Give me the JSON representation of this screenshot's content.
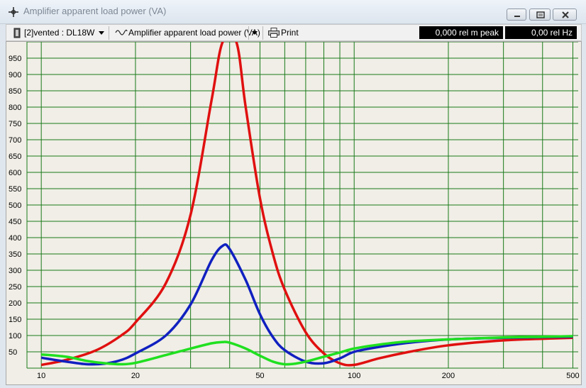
{
  "window": {
    "title": "Amplifier apparent load power (VA)",
    "minimize_label": "minimize",
    "maximize_label": "maximize",
    "close_label": "close"
  },
  "toolbar": {
    "project_select": "[2]vented : DL18W",
    "graph_select": "Amplifier apparent load power (VA)",
    "print_label": "Print",
    "readout_peak": "0,000 rel m peak",
    "readout_hz": "0,00 rel Hz"
  },
  "colors": {
    "grid": "#1a7a1a",
    "background": "#f0eee6",
    "red": "#e01010",
    "blue": "#1020c0",
    "green": "#20e020"
  },
  "chart_data": {
    "type": "line",
    "title": "Amplifier apparent load power (VA)",
    "xlabel": "",
    "ylabel": "",
    "xscale": "log",
    "xlim": [
      9,
      520
    ],
    "ylim": [
      0,
      1000
    ],
    "x_tick_labels": [
      "10",
      "20",
      "50",
      "100",
      "200",
      "500"
    ],
    "y_tick_labels": [
      "50",
      "100",
      "150",
      "200",
      "250",
      "300",
      "350",
      "400",
      "450",
      "500",
      "550",
      "600",
      "650",
      "700",
      "750",
      "800",
      "850",
      "900",
      "950"
    ],
    "grid": true,
    "series": [
      {
        "color": "#e01010",
        "x": [
          10,
          12,
          15,
          18,
          20,
          25,
          30,
          35,
          38,
          42,
          45,
          50,
          55,
          60,
          70,
          80,
          90,
          100,
          120,
          150,
          200,
          300,
          400,
          500
        ],
        "y": [
          10,
          25,
          55,
          100,
          140,
          260,
          470,
          820,
          1000,
          1000,
          800,
          520,
          350,
          240,
          110,
          45,
          15,
          10,
          30,
          50,
          70,
          85,
          90,
          93
        ]
      },
      {
        "color": "#1020c0",
        "x": [
          10,
          12,
          14,
          16,
          18,
          20,
          25,
          30,
          35,
          38,
          40,
          45,
          50,
          55,
          60,
          70,
          80,
          90,
          100,
          120,
          150,
          200,
          300,
          400,
          500
        ],
        "y": [
          32,
          20,
          12,
          14,
          25,
          45,
          100,
          195,
          330,
          375,
          365,
          270,
          165,
          95,
          55,
          20,
          15,
          30,
          50,
          65,
          78,
          88,
          93,
          95,
          96
        ]
      },
      {
        "color": "#20e020",
        "x": [
          10,
          12,
          14,
          16,
          18,
          20,
          25,
          30,
          35,
          38,
          40,
          45,
          50,
          55,
          60,
          65,
          70,
          80,
          90,
          100,
          120,
          150,
          200,
          300,
          400,
          500
        ],
        "y": [
          42,
          35,
          22,
          15,
          12,
          16,
          40,
          60,
          76,
          80,
          78,
          60,
          38,
          20,
          12,
          14,
          20,
          35,
          48,
          60,
          72,
          82,
          88,
          94,
          96,
          98
        ]
      }
    ]
  }
}
